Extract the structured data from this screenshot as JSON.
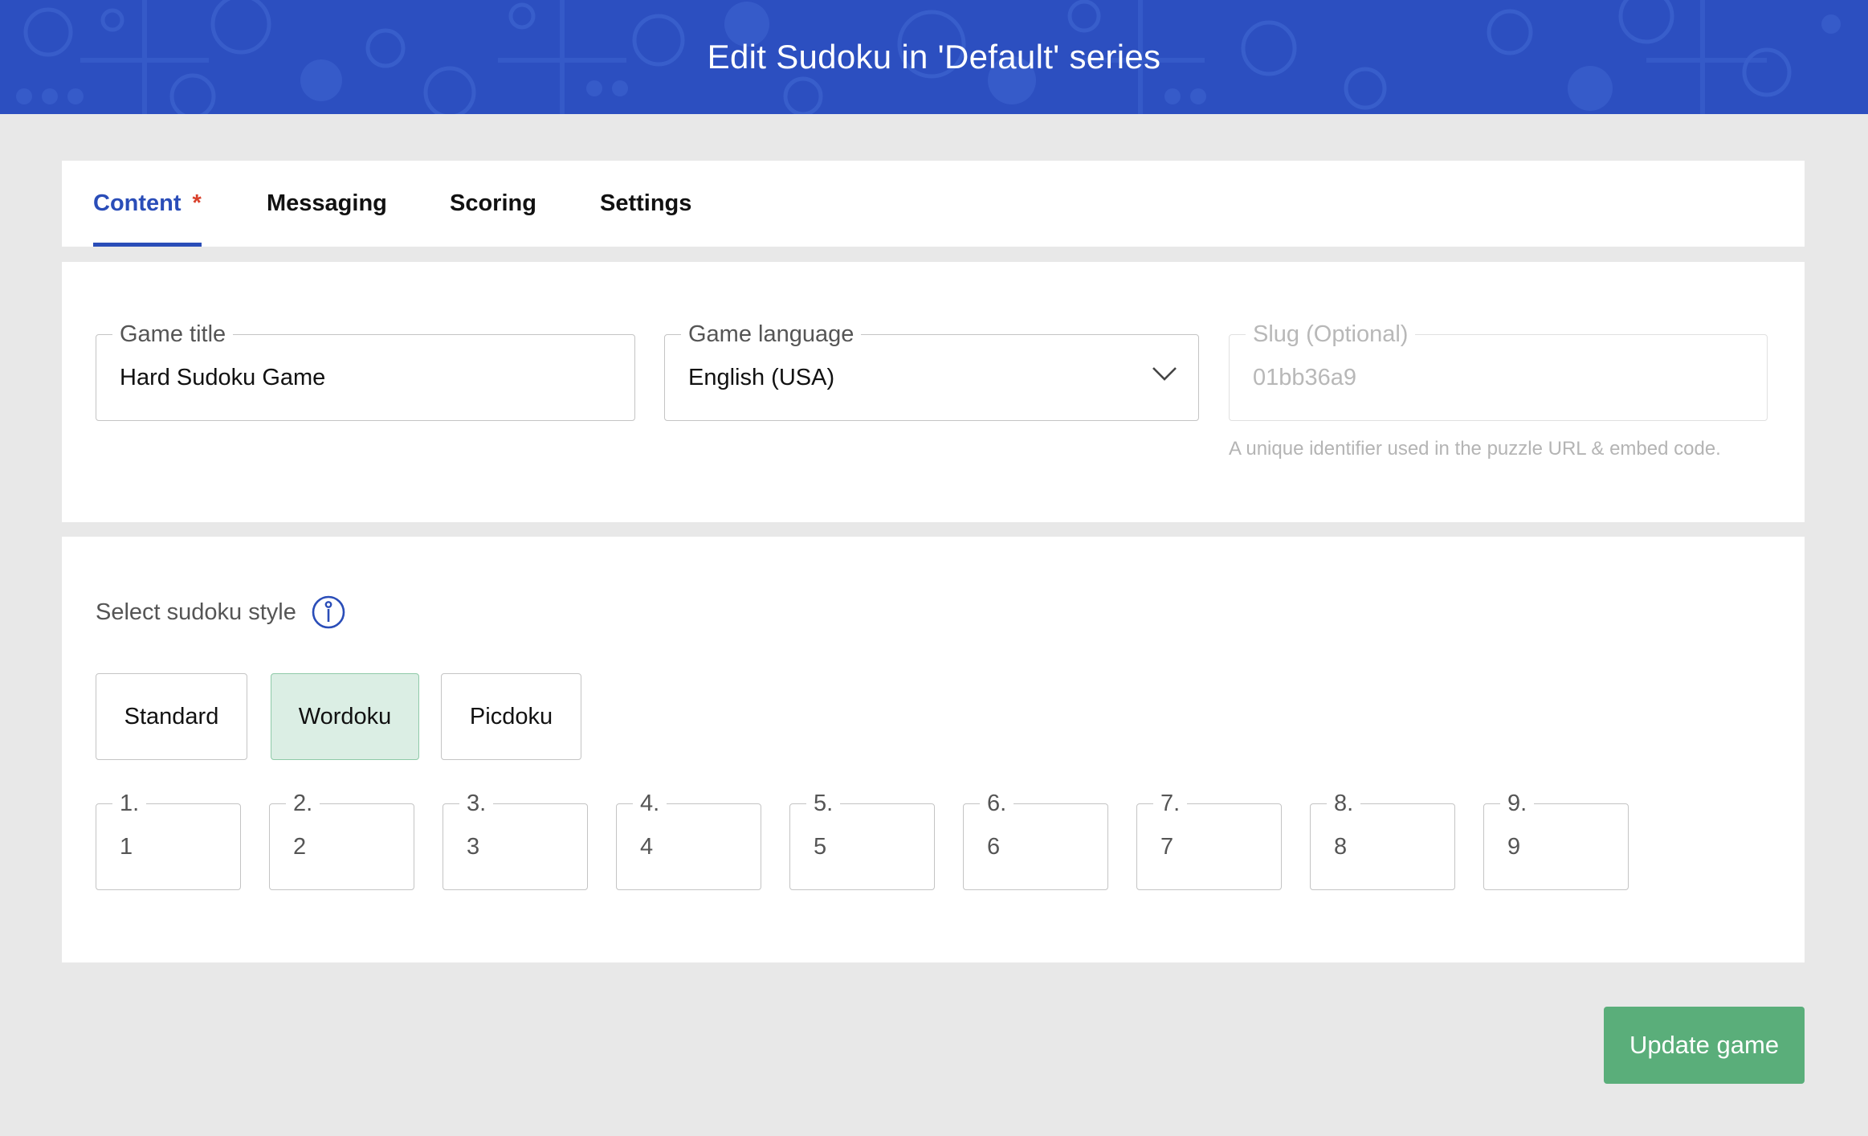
{
  "header": {
    "title": "Edit Sudoku in 'Default' series"
  },
  "tabs": [
    {
      "label": "Content",
      "required_marker": "*",
      "active": true
    },
    {
      "label": "Messaging"
    },
    {
      "label": "Scoring"
    },
    {
      "label": "Settings"
    }
  ],
  "fields": {
    "game_title": {
      "label": "Game title",
      "value": "Hard Sudoku Game"
    },
    "game_language": {
      "label": "Game language",
      "value": "English (USA)"
    },
    "slug": {
      "label": "Slug (Optional)",
      "value": "01bb36a9",
      "helper": "A unique identifier used in the puzzle URL & embed code."
    }
  },
  "sudoku_style": {
    "label": "Select sudoku style",
    "options": [
      "Standard",
      "Wordoku",
      "Picdoku"
    ],
    "selected": "Wordoku"
  },
  "word_fields": [
    {
      "label": "1.",
      "value": "1"
    },
    {
      "label": "2.",
      "value": "2"
    },
    {
      "label": "3.",
      "value": "3"
    },
    {
      "label": "4.",
      "value": "4"
    },
    {
      "label": "5.",
      "value": "5"
    },
    {
      "label": "6.",
      "value": "6"
    },
    {
      "label": "7.",
      "value": "7"
    },
    {
      "label": "8.",
      "value": "8"
    },
    {
      "label": "9.",
      "value": "9"
    }
  ],
  "update_button": {
    "label": "Update game"
  },
  "colors": {
    "header_bg": "#2c4fc0",
    "accent": "#2a4db8",
    "required": "#d9402b",
    "selected_option_bg": "#dbeee4",
    "primary_button": "#5aae7a"
  }
}
